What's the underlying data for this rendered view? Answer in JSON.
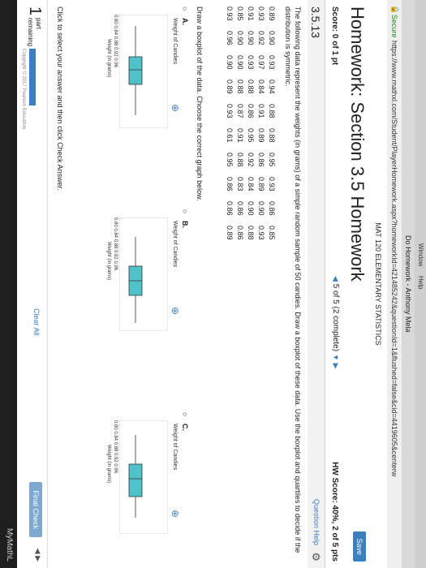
{
  "browser": {
    "menu": [
      "Window",
      "Help"
    ],
    "tab_title": "Do Homework - Anthony Mela",
    "secure_label": "Secure",
    "url": "https://www.mathxl.com/Student/PlayerHomework.aspx?homeworkId=421485242&questionId=1&flushed=false&cid=4419605&centerw"
  },
  "course": {
    "name": "MAT 120 ELEMENTARY STATISTICS"
  },
  "homework": {
    "title": "Homework: Section 3.5 Homework",
    "save_label": "Save",
    "score": "Score: 0 of 1 pt",
    "pager": "5 of 5 (2 complete)",
    "hw_score": "HW Score: 40%, 2 of 5 pts",
    "question_number": "3.5.13",
    "question_help": "Question Help"
  },
  "question": {
    "instruction": "The following data represent the weights (in grams) of a simple random sample of 50 candies. Draw a boxplot of these data. Use the boxplot and quartiles to decide if the distribution is symmetric.",
    "data_rows": [
      [
        "0.89",
        "0.90",
        "0.93",
        "0.94",
        "0.88",
        "0.88",
        "0.95",
        "0.93",
        "0.86",
        "0.85"
      ],
      [
        "0.93",
        "0.92",
        "0.97",
        "0.84",
        "0.91",
        "0.89",
        "0.86",
        "0.89",
        "0.90",
        "0.93"
      ],
      [
        "0.91",
        "0.90",
        "0.93",
        "0.88",
        "0.86",
        "0.95",
        "0.92",
        "0.84",
        "0.90",
        "0.88"
      ],
      [
        "0.85",
        "0.90",
        "0.90",
        "0.88",
        "0.87",
        "0.91",
        "0.88",
        "0.83",
        "0.86",
        "0.86"
      ],
      [
        "0.93",
        "0.96",
        "0.90",
        "0.89",
        "0.93",
        "0.61",
        "0.95",
        "0.86",
        "0.86",
        "0.89"
      ]
    ],
    "draw_prompt": "Draw a boxplot of the data. Choose the correct graph below.",
    "options": [
      {
        "letter": "A.",
        "graph_title": "Weight of Candies",
        "ticks": "0.80 0.84 0.88 0.92 0.96",
        "xlabel": "Weight (in grams)"
      },
      {
        "letter": "B.",
        "graph_title": "Weight of Candies",
        "ticks": "0.80 0.84 0.88 0.92 0.96",
        "xlabel": "Weight (in grams)"
      },
      {
        "letter": "C.",
        "graph_title": "Weight of Candies",
        "ticks": "0.80 0.84 0.88 0.92 0.96",
        "xlabel": "Weight (in grams)"
      }
    ],
    "click_note": "Click to select your answer and then click Check Answer."
  },
  "footer": {
    "parts_count": "1",
    "parts_label": "part",
    "remaining_label": "remaining",
    "clear_all": "Clear All",
    "final_check": "Final Check",
    "copyright": "Copyright © 2017 Pearson Education"
  },
  "brand": {
    "name": "MyMathL"
  },
  "colors": {
    "accent": "#3a7fc1",
    "box_fill": "#4fc1c8",
    "secure_green": "#1a8a1a"
  }
}
